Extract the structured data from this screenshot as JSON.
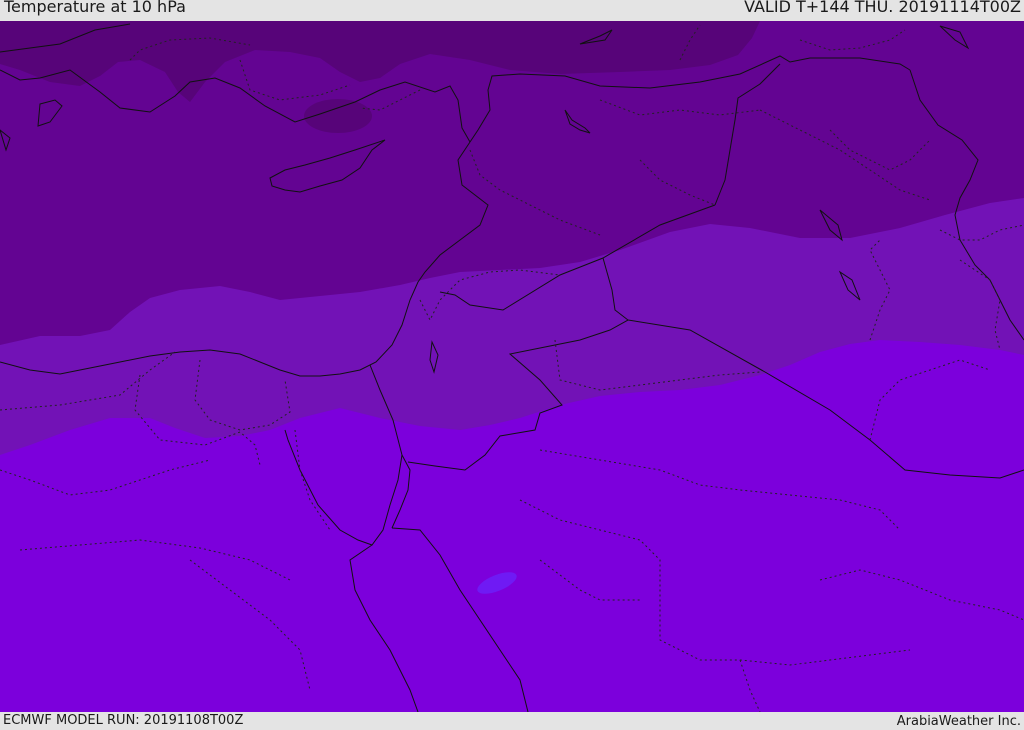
{
  "header": {
    "title": "Temperature at 10 hPa",
    "valid_time": "VALID T+144 THU. 20191114T00Z"
  },
  "footer": {
    "model_run": "ECMWF MODEL RUN: 20191108T00Z",
    "credit": "ArabiaWeather Inc."
  },
  "colors": {
    "band_coldest": "#570479",
    "band_cold": "#630492",
    "band_mid": "#7212b6",
    "band_warm": "#7c00dc",
    "warm_spot": "#6f1af4",
    "coastline": "#111111",
    "background": "#e4e4e4"
  }
}
